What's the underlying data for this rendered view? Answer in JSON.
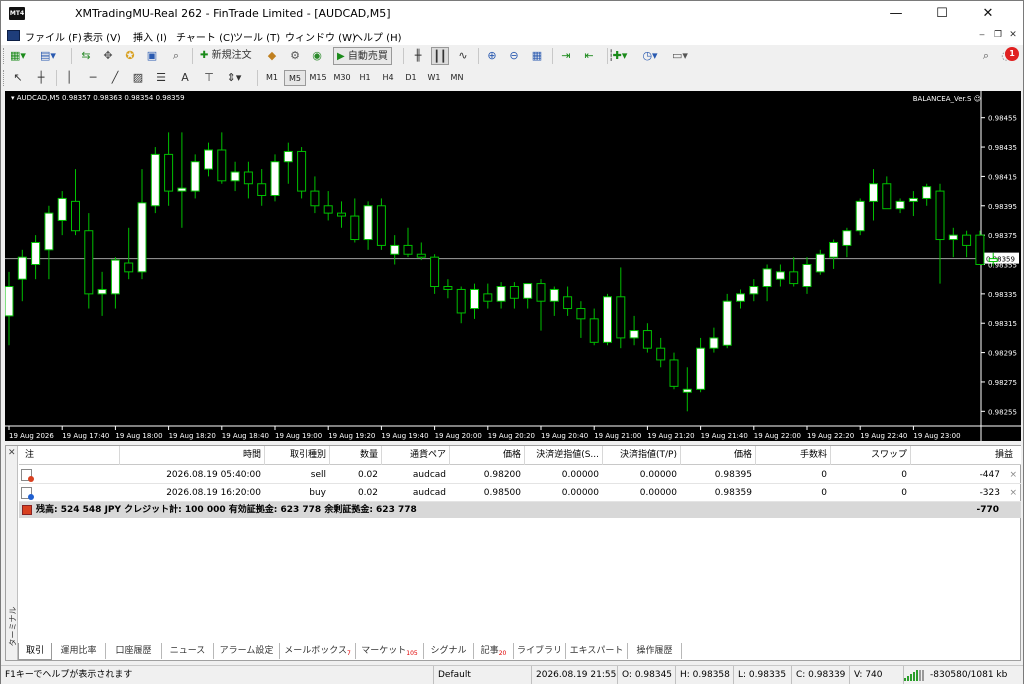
{
  "window": {
    "title": "XMTradingMU-Real 262 - FinTrade Limited - [AUDCAD,M5]",
    "app_icon_text": "MT4",
    "minimize": "—",
    "maximize": "☐",
    "close": "✕"
  },
  "menu": {
    "items": [
      "ファイル (F)",
      "表示 (V)",
      "挿入 (I)",
      "チャート (C)",
      "ツール (T)",
      "ウィンドウ (W)",
      "ヘルプ (H)"
    ],
    "mdi_min": "‒",
    "mdi_restore": "❐",
    "mdi_close": "✕"
  },
  "toolbar": {
    "new_order_label": "新規注文",
    "auto_trading_label": "自動売買",
    "notification_count": "1",
    "timeframes": [
      "M1",
      "M5",
      "M15",
      "M30",
      "H1",
      "H4",
      "D1",
      "W1",
      "MN"
    ],
    "active_timeframe": "M5",
    "text_tool": "A"
  },
  "chart": {
    "header": "AUDCAD,M5  0.98357 0.98363 0.98354 0.98359",
    "ea_label": "BALANCEA_Ver.S ☺",
    "colors": {
      "background": "#000000",
      "bull_candle": "#ffffff",
      "bear_candle": "#000000",
      "wick": "#00c000",
      "price_line": "#a0a0a0",
      "axis_text": "#ffffff"
    },
    "current_price": "0.98359"
  },
  "chart_data": {
    "type": "candlestick",
    "symbol": "AUDCAD",
    "timeframe": "M5",
    "ylim": [
      0.98245,
      0.98465
    ],
    "y_ticks": [
      "0.98455",
      "0.98435",
      "0.98415",
      "0.98395",
      "0.98375",
      "0.98355",
      "0.98335",
      "0.98315",
      "0.98295",
      "0.98275",
      "0.98255"
    ],
    "x_ticks": [
      "19 Aug 2026",
      "19 Aug 17:40",
      "19 Aug 18:00",
      "19 Aug 18:20",
      "19 Aug 18:40",
      "19 Aug 19:00",
      "19 Aug 19:20",
      "19 Aug 19:40",
      "19 Aug 20:00",
      "19 Aug 20:20",
      "19 Aug 20:40",
      "19 Aug 21:00",
      "19 Aug 21:20",
      "19 Aug 21:40",
      "19 Aug 22:00",
      "19 Aug 22:20",
      "19 Aug 22:40",
      "19 Aug 23:00"
    ],
    "x_tick_bar_index": [
      0,
      4,
      8,
      12,
      16,
      20,
      24,
      28,
      32,
      36,
      40,
      44,
      48,
      52,
      56,
      60,
      64,
      68
    ],
    "current_price": 0.98359,
    "candles": [
      {
        "o": 0.9832,
        "h": 0.9835,
        "l": 0.983,
        "c": 0.9834
      },
      {
        "o": 0.98345,
        "h": 0.98365,
        "l": 0.9833,
        "c": 0.9836
      },
      {
        "o": 0.98355,
        "h": 0.98375,
        "l": 0.98345,
        "c": 0.9837
      },
      {
        "o": 0.98365,
        "h": 0.98395,
        "l": 0.98345,
        "c": 0.9839
      },
      {
        "o": 0.98385,
        "h": 0.98405,
        "l": 0.98375,
        "c": 0.984
      },
      {
        "o": 0.98398,
        "h": 0.9842,
        "l": 0.98375,
        "c": 0.98378
      },
      {
        "o": 0.98378,
        "h": 0.9839,
        "l": 0.98325,
        "c": 0.98335
      },
      {
        "o": 0.98335,
        "h": 0.9835,
        "l": 0.9832,
        "c": 0.98338
      },
      {
        "o": 0.98335,
        "h": 0.9836,
        "l": 0.98325,
        "c": 0.98358
      },
      {
        "o": 0.98356,
        "h": 0.9838,
        "l": 0.98345,
        "c": 0.9835
      },
      {
        "o": 0.9835,
        "h": 0.9842,
        "l": 0.98345,
        "c": 0.98397
      },
      {
        "o": 0.98395,
        "h": 0.98435,
        "l": 0.9839,
        "c": 0.9843
      },
      {
        "o": 0.9843,
        "h": 0.98445,
        "l": 0.98395,
        "c": 0.98405
      },
      {
        "o": 0.98405,
        "h": 0.98445,
        "l": 0.9838,
        "c": 0.98407
      },
      {
        "o": 0.98405,
        "h": 0.9843,
        "l": 0.984,
        "c": 0.98425
      },
      {
        "o": 0.9842,
        "h": 0.98438,
        "l": 0.98415,
        "c": 0.98433
      },
      {
        "o": 0.98433,
        "h": 0.98445,
        "l": 0.9841,
        "c": 0.98412
      },
      {
        "o": 0.98412,
        "h": 0.98425,
        "l": 0.98405,
        "c": 0.98418
      },
      {
        "o": 0.98418,
        "h": 0.98425,
        "l": 0.984,
        "c": 0.9841
      },
      {
        "o": 0.9841,
        "h": 0.9842,
        "l": 0.98395,
        "c": 0.98402
      },
      {
        "o": 0.98402,
        "h": 0.9843,
        "l": 0.98398,
        "c": 0.98425
      },
      {
        "o": 0.98425,
        "h": 0.98438,
        "l": 0.9841,
        "c": 0.98432
      },
      {
        "o": 0.98432,
        "h": 0.98435,
        "l": 0.984,
        "c": 0.98405
      },
      {
        "o": 0.98405,
        "h": 0.98415,
        "l": 0.9839,
        "c": 0.98395
      },
      {
        "o": 0.98395,
        "h": 0.98405,
        "l": 0.98385,
        "c": 0.9839
      },
      {
        "o": 0.9839,
        "h": 0.98398,
        "l": 0.9838,
        "c": 0.98388
      },
      {
        "o": 0.98388,
        "h": 0.984,
        "l": 0.9837,
        "c": 0.98372
      },
      {
        "o": 0.98372,
        "h": 0.98398,
        "l": 0.98365,
        "c": 0.98395
      },
      {
        "o": 0.98395,
        "h": 0.984,
        "l": 0.98365,
        "c": 0.98368
      },
      {
        "o": 0.98362,
        "h": 0.98375,
        "l": 0.98355,
        "c": 0.98368
      },
      {
        "o": 0.98368,
        "h": 0.9838,
        "l": 0.9836,
        "c": 0.98362
      },
      {
        "o": 0.98362,
        "h": 0.9837,
        "l": 0.98358,
        "c": 0.9836
      },
      {
        "o": 0.9836,
        "h": 0.98362,
        "l": 0.98335,
        "c": 0.9834
      },
      {
        "o": 0.9834,
        "h": 0.98345,
        "l": 0.98332,
        "c": 0.98338
      },
      {
        "o": 0.98338,
        "h": 0.9834,
        "l": 0.98315,
        "c": 0.98322
      },
      {
        "o": 0.98325,
        "h": 0.98342,
        "l": 0.98318,
        "c": 0.98338
      },
      {
        "o": 0.98335,
        "h": 0.98342,
        "l": 0.98325,
        "c": 0.9833
      },
      {
        "o": 0.9833,
        "h": 0.98343,
        "l": 0.98325,
        "c": 0.9834
      },
      {
        "o": 0.9834,
        "h": 0.98343,
        "l": 0.98325,
        "c": 0.98332
      },
      {
        "o": 0.98332,
        "h": 0.98342,
        "l": 0.98325,
        "c": 0.98342
      },
      {
        "o": 0.98342,
        "h": 0.98345,
        "l": 0.9831,
        "c": 0.9833
      },
      {
        "o": 0.9833,
        "h": 0.9834,
        "l": 0.9832,
        "c": 0.98338
      },
      {
        "o": 0.98333,
        "h": 0.9834,
        "l": 0.9832,
        "c": 0.98325
      },
      {
        "o": 0.98325,
        "h": 0.9833,
        "l": 0.98305,
        "c": 0.98318
      },
      {
        "o": 0.98318,
        "h": 0.98325,
        "l": 0.983,
        "c": 0.98302
      },
      {
        "o": 0.98302,
        "h": 0.98335,
        "l": 0.983,
        "c": 0.98333
      },
      {
        "o": 0.98333,
        "h": 0.98353,
        "l": 0.98298,
        "c": 0.98305
      },
      {
        "o": 0.98305,
        "h": 0.9832,
        "l": 0.983,
        "c": 0.9831
      },
      {
        "o": 0.9831,
        "h": 0.98315,
        "l": 0.98295,
        "c": 0.98298
      },
      {
        "o": 0.98298,
        "h": 0.98305,
        "l": 0.98285,
        "c": 0.9829
      },
      {
        "o": 0.9829,
        "h": 0.98295,
        "l": 0.9827,
        "c": 0.98272
      },
      {
        "o": 0.98268,
        "h": 0.98285,
        "l": 0.98255,
        "c": 0.9827
      },
      {
        "o": 0.9827,
        "h": 0.98305,
        "l": 0.98268,
        "c": 0.98298
      },
      {
        "o": 0.98298,
        "h": 0.98312,
        "l": 0.98295,
        "c": 0.98305
      },
      {
        "o": 0.983,
        "h": 0.98335,
        "l": 0.98298,
        "c": 0.9833
      },
      {
        "o": 0.9833,
        "h": 0.98338,
        "l": 0.98325,
        "c": 0.98335
      },
      {
        "o": 0.98335,
        "h": 0.98345,
        "l": 0.9833,
        "c": 0.9834
      },
      {
        "o": 0.9834,
        "h": 0.98355,
        "l": 0.9833,
        "c": 0.98352
      },
      {
        "o": 0.98345,
        "h": 0.98355,
        "l": 0.9834,
        "c": 0.9835
      },
      {
        "o": 0.9835,
        "h": 0.9836,
        "l": 0.9834,
        "c": 0.98342
      },
      {
        "o": 0.9834,
        "h": 0.9836,
        "l": 0.98335,
        "c": 0.98355
      },
      {
        "o": 0.9835,
        "h": 0.98365,
        "l": 0.98348,
        "c": 0.98362
      },
      {
        "o": 0.9836,
        "h": 0.98372,
        "l": 0.98352,
        "c": 0.9837
      },
      {
        "o": 0.98368,
        "h": 0.9838,
        "l": 0.9836,
        "c": 0.98378
      },
      {
        "o": 0.98378,
        "h": 0.984,
        "l": 0.98375,
        "c": 0.98398
      },
      {
        "o": 0.98398,
        "h": 0.9842,
        "l": 0.98385,
        "c": 0.9841
      },
      {
        "o": 0.9841,
        "h": 0.98415,
        "l": 0.98395,
        "c": 0.98393
      },
      {
        "o": 0.98393,
        "h": 0.984,
        "l": 0.9839,
        "c": 0.98398
      },
      {
        "o": 0.98398,
        "h": 0.98405,
        "l": 0.98388,
        "c": 0.984
      },
      {
        "o": 0.984,
        "h": 0.9841,
        "l": 0.98395,
        "c": 0.98408
      },
      {
        "o": 0.98405,
        "h": 0.9841,
        "l": 0.98342,
        "c": 0.98372
      },
      {
        "o": 0.98372,
        "h": 0.9838,
        "l": 0.9836,
        "c": 0.98375
      },
      {
        "o": 0.98375,
        "h": 0.98378,
        "l": 0.9836,
        "c": 0.98368
      },
      {
        "o": 0.98375,
        "h": 0.98378,
        "l": 0.98355,
        "c": 0.98355
      },
      {
        "o": 0.98357,
        "h": 0.98363,
        "l": 0.98354,
        "c": 0.98359
      }
    ]
  },
  "terminal": {
    "side_label": "ターミナル",
    "close_icon": "✕",
    "columns": [
      "注",
      "時間",
      "取引種別",
      "数量",
      "通貨ペア",
      "価格",
      "決済逆指値(S...",
      "決済指値(T/P)",
      "価格",
      "手数料",
      "スワップ",
      "損益"
    ],
    "rows": [
      {
        "order": "",
        "time": "2026.08.19 05:40:00",
        "type": "sell",
        "volume": "0.02",
        "symbol": "audcad",
        "price": "0.98200",
        "sl": "0.00000",
        "tp": "0.00000",
        "cur_price": "0.98395",
        "commission": "0",
        "swap": "0",
        "profit": "-447",
        "close": "×"
      },
      {
        "order": "",
        "time": "2026.08.19 16:20:00",
        "type": "buy",
        "volume": "0.02",
        "symbol": "audcad",
        "price": "0.98500",
        "sl": "0.00000",
        "tp": "0.00000",
        "cur_price": "0.98359",
        "commission": "0",
        "swap": "0",
        "profit": "-323",
        "close": "×"
      }
    ],
    "balance_text": "残高: 524 548 JPY  クレジット計: 100 000  有効証拠金: 623 778  余剰証拠金: 623 778",
    "total_profit": "-770"
  },
  "tabs": [
    {
      "label": "取引",
      "badge": ""
    },
    {
      "label": "運用比率",
      "badge": ""
    },
    {
      "label": "口座履歴",
      "badge": ""
    },
    {
      "label": "ニュース",
      "badge": ""
    },
    {
      "label": "アラーム設定",
      "badge": ""
    },
    {
      "label": "メールボックス",
      "badge": "7"
    },
    {
      "label": "マーケット",
      "badge": "105"
    },
    {
      "label": "シグナル",
      "badge": ""
    },
    {
      "label": "記事",
      "badge": "20"
    },
    {
      "label": "ライブラリ",
      "badge": ""
    },
    {
      "label": "エキスパート",
      "badge": ""
    },
    {
      "label": "操作履歴",
      "badge": ""
    }
  ],
  "status": {
    "help": "F1キーでヘルプが表示されます",
    "profile": "Default",
    "datetime": "2026.08.19 21:55",
    "open": "O: 0.98345",
    "high": "H: 0.98358",
    "low": "L: 0.98335",
    "close": "C: 0.98339",
    "volume": "V: 740",
    "traffic": "-830580/1081 kb"
  }
}
